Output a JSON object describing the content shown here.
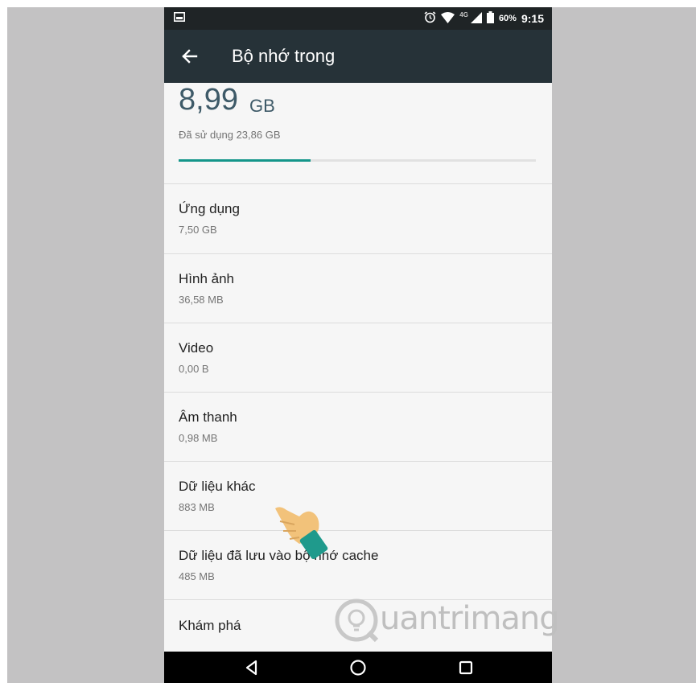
{
  "status_bar": {
    "network": "4G",
    "battery": "60%",
    "time": "9:15"
  },
  "app_bar": {
    "title": "Bộ nhớ trong"
  },
  "summary": {
    "used_amount": "8,99",
    "used_unit": "GB",
    "total_label": "Đã sử dụng 23,86 GB",
    "progress_fraction": 0.37
  },
  "storage_items": [
    {
      "label": "Ứng dụng",
      "size": "7,50 GB"
    },
    {
      "label": "Hình ảnh",
      "size": "36,58 MB"
    },
    {
      "label": "Video",
      "size": "0,00 B"
    },
    {
      "label": "Âm thanh",
      "size": "0,98 MB"
    },
    {
      "label": "Dữ liệu khác",
      "size": "883 MB"
    },
    {
      "label": "Dữ liệu đã lưu vào bộ nhớ cache",
      "size": "485 MB"
    },
    {
      "label": "Khám phá",
      "size": ""
    }
  ],
  "watermark": {
    "text": "uantrimang"
  },
  "colors": {
    "app_bar": "#263238",
    "status_bar": "#1f2426",
    "accent": "#14968a",
    "background": "#f6f6f6"
  },
  "icons": {
    "status_left": "image-icon",
    "status_right": [
      "alarm-icon",
      "wifi-icon",
      "signal-icon",
      "battery-icon"
    ],
    "nav": [
      "back-triangle-icon",
      "home-circle-icon",
      "recents-square-icon"
    ]
  }
}
